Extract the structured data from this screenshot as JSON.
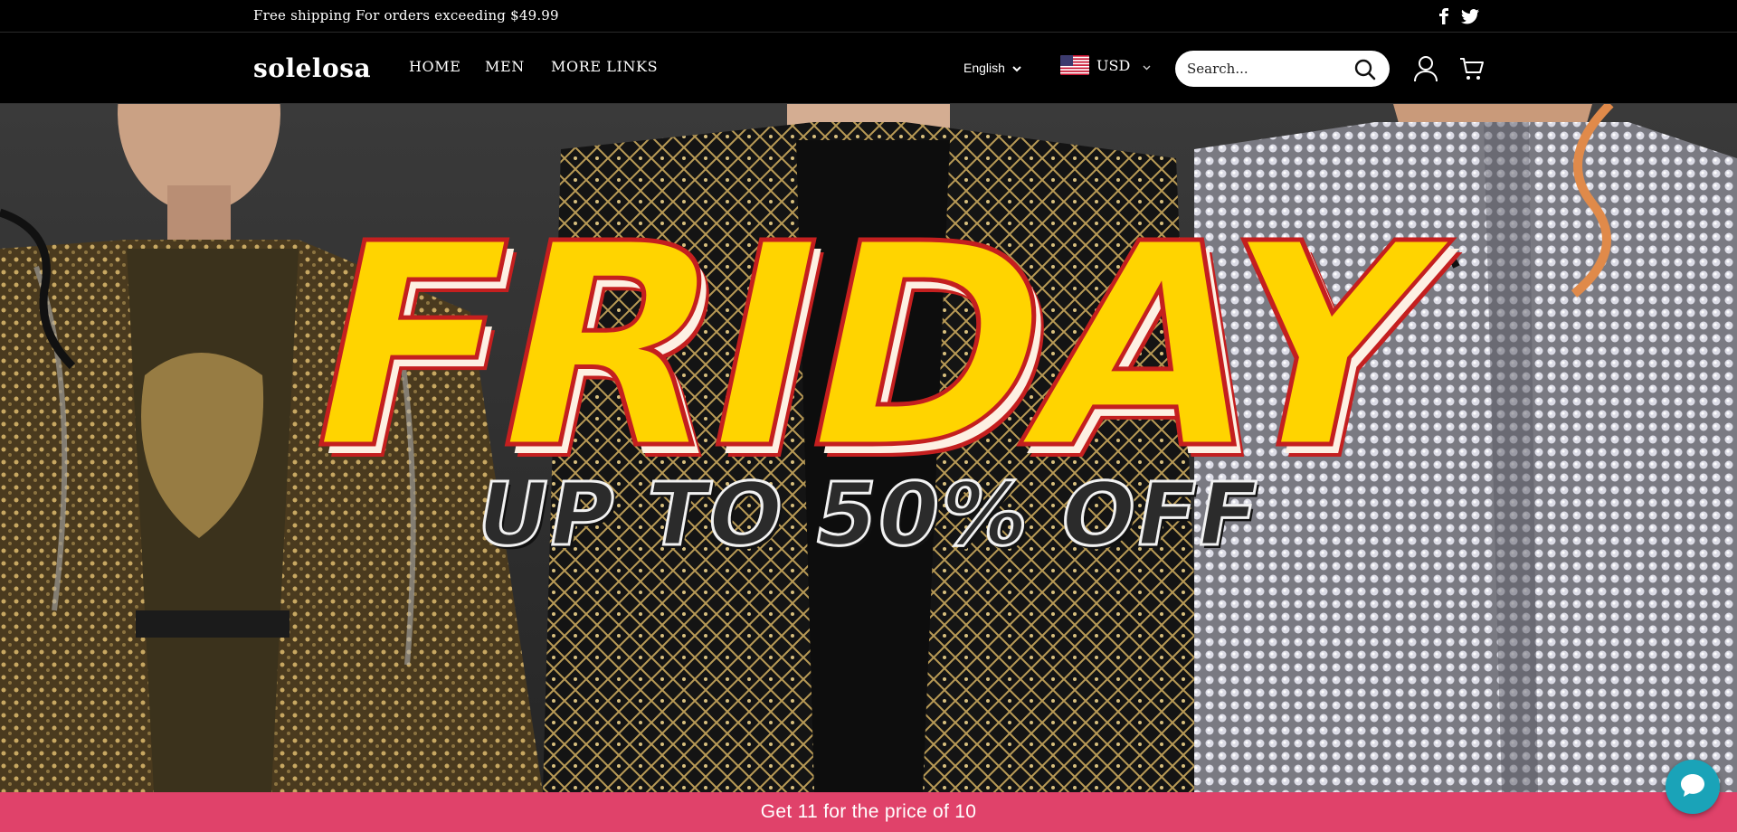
{
  "announcement": {
    "text": "Free shipping For orders exceeding $49.99",
    "social": [
      "facebook-icon",
      "twitter-icon"
    ]
  },
  "header": {
    "logo": "solelosa",
    "nav": [
      {
        "label": "HOME"
      },
      {
        "label": "MEN"
      },
      {
        "label": "MORE LINKS"
      }
    ],
    "language": "English",
    "currency": "USD",
    "search_placeholder": "Search...",
    "icons": [
      "search-icon",
      "account-icon",
      "cart-icon"
    ]
  },
  "hero": {
    "title": "FRIDAY",
    "subtitle": "UP TO 50% OFF",
    "title_color": "#ffd400",
    "title_outline_color": "#c41f1f"
  },
  "promo_bar": {
    "text": "Get 11 for the price of 10",
    "color": "#e0426a"
  },
  "chat": {
    "icon": "chat-bubble-icon",
    "color": "#1aa3b8"
  }
}
